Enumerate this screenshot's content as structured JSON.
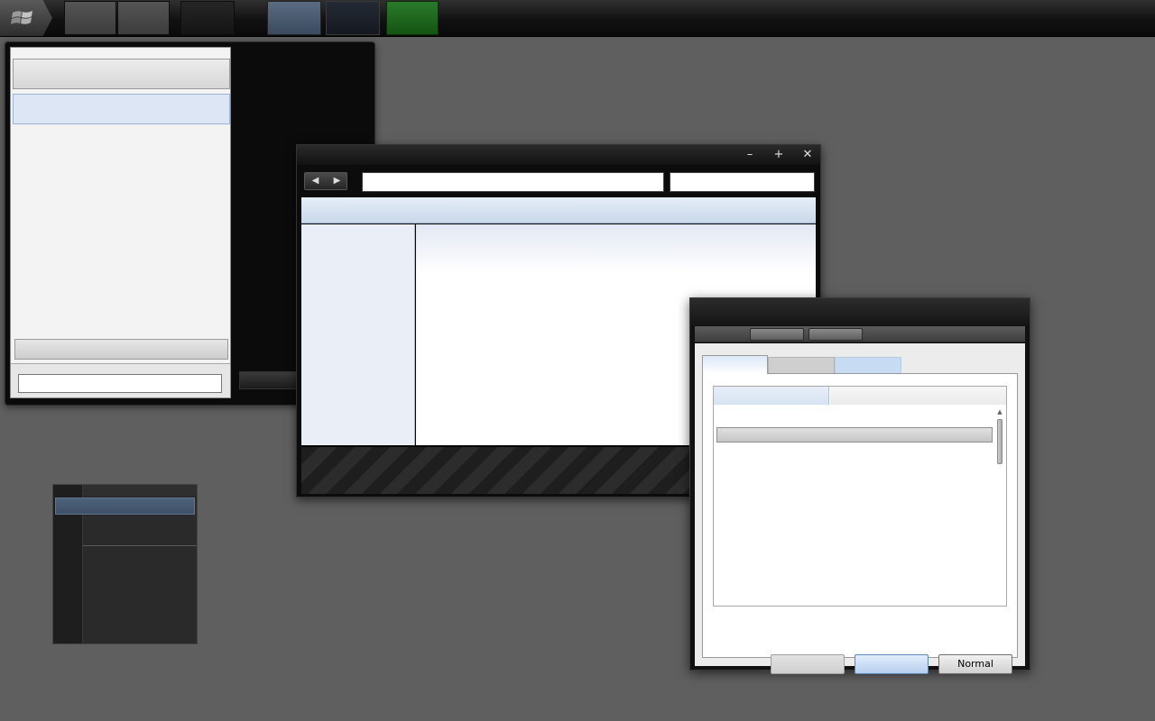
{
  "taskbar": {
    "start_icon": "windows-flag-icon",
    "buttons": [
      "",
      "",
      "",
      "",
      "",
      ""
    ]
  },
  "explorer": {
    "title": "",
    "minimize_glyph": "–",
    "maximize_glyph": "+",
    "close_glyph": "✕",
    "back_glyph": "◀",
    "forward_glyph": "▶",
    "address_value": "",
    "search_value": ""
  },
  "start_menu": {
    "search_value": ""
  },
  "dialog": {
    "tabs": [
      "",
      "",
      ""
    ],
    "buttons": {
      "disabled_label": "",
      "hover_label": "",
      "normal_label": "Normal"
    },
    "scroll_up_glyph": "▲"
  },
  "colors": {
    "desktop": "#5f5f5f",
    "accent_blue": "#c7dbf3",
    "taskbar_green": "#145414"
  }
}
